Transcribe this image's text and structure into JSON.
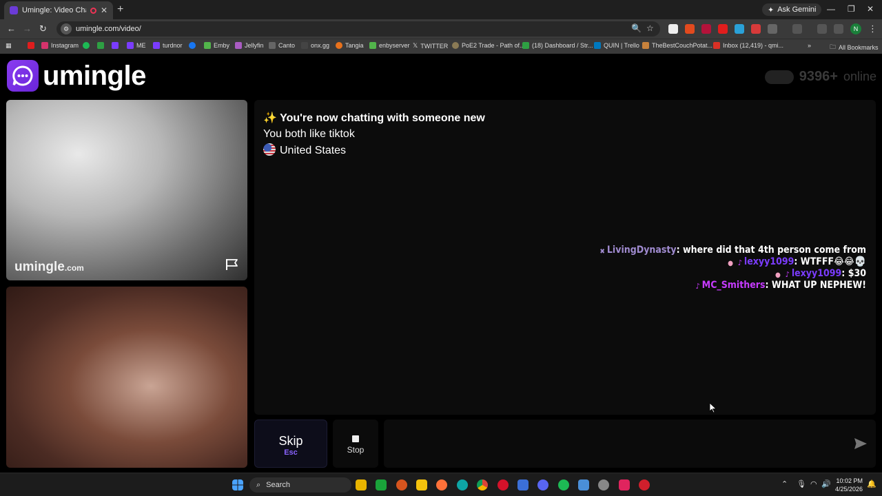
{
  "browser": {
    "tab_title": "Umingle: Video Chat with S",
    "new_tab": "+",
    "ask_gemini": "Ask Gemini",
    "url": "umingle.com/video/",
    "all_bookmarks": "All Bookmarks",
    "profile_initial": "N",
    "bookmarks": [
      {
        "label": "Instagram",
        "color": "#d6336c"
      },
      {
        "label": "ME",
        "color": "#7b3cff"
      },
      {
        "label": "turdnor",
        "color": "#7b3cff"
      },
      {
        "label": "Emby",
        "color": "#52b54b"
      },
      {
        "label": "Jellyfin",
        "color": "#aa5cc3"
      },
      {
        "label": "Canto",
        "color": "#666666"
      },
      {
        "label": "onx.gg",
        "color": "#444444"
      },
      {
        "label": "Tangia",
        "color": "#e8711c"
      },
      {
        "label": "enbyserver",
        "color": "#52b54b"
      },
      {
        "label": "TWITTER",
        "color": "#000000"
      },
      {
        "label": "PoE2 Trade - Path of...",
        "color": "#8a7a55"
      },
      {
        "label": "(18) Dashboard / Str...",
        "color": "#2ea043"
      },
      {
        "label": "QUIN | Trello",
        "color": "#0079bf"
      },
      {
        "label": "TheBestCouchPotat...",
        "color": "#c8823c"
      },
      {
        "label": "Inbox (12,419) - qmi...",
        "color": "#d93025"
      }
    ]
  },
  "site": {
    "logo_text": "umingle",
    "online_count": "9396+",
    "online_label": "online"
  },
  "remote_video": {
    "watermark": "umingle",
    "watermark_suffix": ".com"
  },
  "chat": {
    "title_emoji": "✨",
    "title": "You're now chatting with someone new",
    "common_interest": "You both like tiktok",
    "country": "United States",
    "messages": [
      {
        "user": "LivingDynasty",
        "text": ": where did that 4th person come from",
        "emoji": ""
      },
      {
        "user": "lexyy1099",
        "text": ": WTFFF",
        "emoji": "😂😂💀"
      },
      {
        "user": "lexyy1099",
        "text": ": $30",
        "emoji": ""
      },
      {
        "user": "MC_Smithers",
        "text": ": WHAT UP NEPHEW!",
        "emoji": ""
      }
    ]
  },
  "controls": {
    "skip_label": "Skip",
    "skip_key": "Esc",
    "stop_label": "Stop",
    "message_placeholder": ""
  },
  "taskbar": {
    "search_label": "Search",
    "time": "10:02 PM",
    "date": "4/25/2026"
  }
}
